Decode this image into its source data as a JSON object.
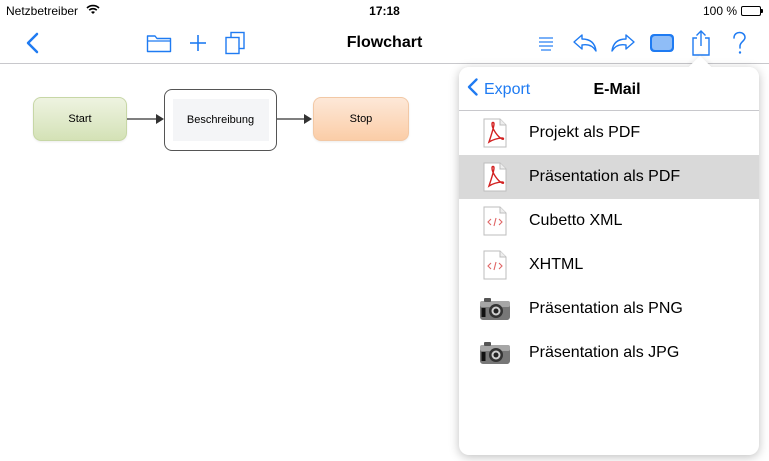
{
  "status_bar": {
    "carrier": "Netzbetreiber",
    "time": "17:18",
    "battery": "100 %"
  },
  "nav": {
    "title": "Flowchart",
    "accent_color": "#1f7bf2",
    "left_icons": [
      "back-chevron-icon"
    ],
    "center_icons": [
      "folder-icon",
      "plus-icon",
      "duplicate-icon"
    ],
    "right_icons": [
      "list-icon",
      "undo-icon",
      "redo-icon",
      "fill-style-icon",
      "share-icon",
      "help-icon"
    ]
  },
  "flowchart": {
    "nodes": [
      {
        "label": "Start"
      },
      {
        "label": "Beschreibung"
      },
      {
        "label": "Stop"
      }
    ]
  },
  "popover": {
    "back_label": "Export",
    "title": "E-Mail",
    "items": [
      {
        "label": "Projekt als PDF",
        "icon": "pdf-icon",
        "selected": false
      },
      {
        "label": "Präsentation als PDF",
        "icon": "pdf-icon",
        "selected": true
      },
      {
        "label": "Cubetto XML",
        "icon": "code-file-icon",
        "selected": false
      },
      {
        "label": "XHTML",
        "icon": "code-file-icon",
        "selected": false
      },
      {
        "label": "Präsentation als PNG",
        "icon": "camera-icon",
        "selected": false
      },
      {
        "label": "Präsentation als JPG",
        "icon": "camera-icon",
        "selected": false
      }
    ]
  }
}
